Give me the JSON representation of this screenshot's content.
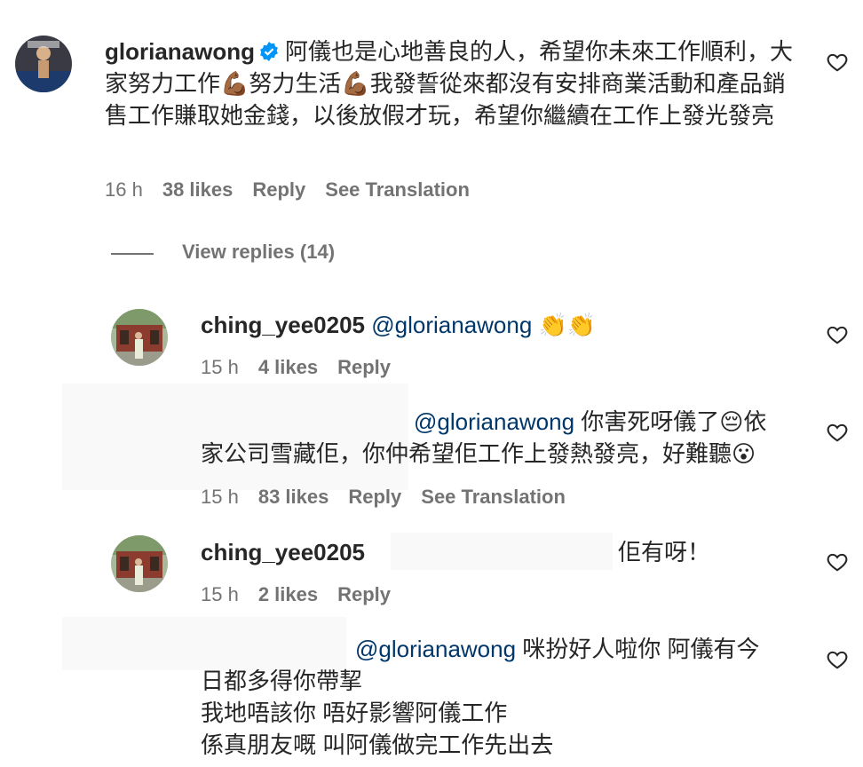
{
  "comments": [
    {
      "username": "glorianawong",
      "verified": true,
      "text": "阿儀也是心地善良的人，希望你未來工作順利，大家努力工作💪🏾努力生活💪🏾我發誓從來都沒有安排商業活動和產品銷售工作賺取她金錢，以後放假才玩，希望你繼續在工作上發光發亮",
      "time": "16 h",
      "likes": "38 likes",
      "reply": "Reply",
      "translation": "See Translation"
    }
  ],
  "view_replies": "View replies (14)",
  "replies": [
    {
      "username": "ching_yee0205",
      "mention": "@glorianawong",
      "text": "👏👏",
      "time": "15 h",
      "likes": "4 likes",
      "reply": "Reply"
    },
    {
      "username": "",
      "mention": "@glorianawong",
      "text_line1": "你害死呀儀了😔依",
      "text_line2": "家公司雪藏佢，你仲希望佢工作上發熱發亮，好難聽😮",
      "time": "15 h",
      "likes": "83 likes",
      "reply": "Reply",
      "translation": "See Translation"
    },
    {
      "username": "ching_yee0205",
      "text": "佢有呀！",
      "time": "15 h",
      "likes": "2 likes",
      "reply": "Reply"
    },
    {
      "username": "",
      "mention": "@glorianawong",
      "text_line1": "咪扮好人啦你 阿儀有今",
      "text_line2": "日都多得你帶挈",
      "text_line3": "我地唔該你 唔好影響阿儀工作",
      "text_line4": "係真朋友嘅 叫阿儀做完工作先出去"
    }
  ],
  "icons": {
    "heart": "heart-outline-icon",
    "verified": "verified-badge-icon"
  },
  "colors": {
    "text": "#262626",
    "meta": "#737373",
    "mention": "#00376b",
    "verified": "#0095f6"
  }
}
